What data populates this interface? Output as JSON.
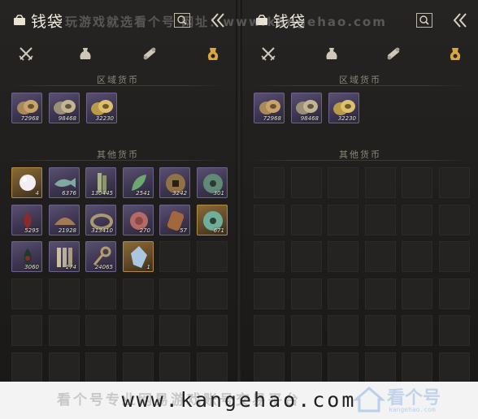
{
  "left_panel": {
    "title": "钱袋",
    "tabs": [
      {
        "icon": "crossed-swords-icon",
        "active": false
      },
      {
        "icon": "pouch-icon",
        "active": false
      },
      {
        "icon": "scroll-icon",
        "active": false
      },
      {
        "icon": "coin-pouch-icon",
        "active": true
      }
    ],
    "regional_label": "区域货币",
    "other_label": "其他货币",
    "regional_items": [
      {
        "icon": "coin-pile-icon",
        "qty": "72968",
        "rarity": "purple"
      },
      {
        "icon": "coin-pile-icon",
        "qty": "98468",
        "rarity": "purple"
      },
      {
        "icon": "coin-pile-icon",
        "qty": "32230",
        "rarity": "purple"
      }
    ],
    "other_items": [
      {
        "icon": "pearl-icon",
        "qty": "4",
        "rarity": "gold"
      },
      {
        "icon": "jade-fish-icon",
        "qty": "6376",
        "rarity": "purple"
      },
      {
        "icon": "bamboo-slip-icon",
        "qty": "130445",
        "rarity": "purple"
      },
      {
        "icon": "green-leaf-icon",
        "qty": "2541",
        "rarity": "purple"
      },
      {
        "icon": "square-hole-coin-icon",
        "qty": "3242",
        "rarity": "purple"
      },
      {
        "icon": "green-coin-icon",
        "qty": "301",
        "rarity": "purple"
      },
      {
        "icon": "red-lotus-icon",
        "qty": "5295",
        "rarity": "purple"
      },
      {
        "icon": "half-shell-icon",
        "qty": "21928",
        "rarity": "purple"
      },
      {
        "icon": "jade-bracelet-icon",
        "qty": "313410",
        "rarity": "purple"
      },
      {
        "icon": "red-stone-icon",
        "qty": "270",
        "rarity": "purple"
      },
      {
        "icon": "carved-token-icon",
        "qty": "57",
        "rarity": "purple"
      },
      {
        "icon": "jade-disc-icon",
        "qty": "671",
        "rarity": "gold"
      },
      {
        "icon": "dark-lotus-icon",
        "qty": "3060",
        "rarity": "purple"
      },
      {
        "icon": "bamboo-scrolls-icon",
        "qty": "174",
        "rarity": "purple"
      },
      {
        "icon": "key-icon",
        "qty": "24065",
        "rarity": "purple"
      },
      {
        "icon": "crystal-icon",
        "qty": "1",
        "rarity": "gold"
      }
    ]
  },
  "right_panel": {
    "title": "钱袋",
    "tabs": [
      {
        "icon": "crossed-swords-icon",
        "active": false
      },
      {
        "icon": "pouch-icon",
        "active": false
      },
      {
        "icon": "scroll-icon",
        "active": false
      },
      {
        "icon": "coin-pouch-icon",
        "active": true
      }
    ],
    "regional_label": "区域货币",
    "other_label": "其他货币",
    "regional_items": [
      {
        "icon": "coin-pile-icon",
        "qty": "72968",
        "rarity": "purple"
      },
      {
        "icon": "coin-pile-icon",
        "qty": "98468",
        "rarity": "purple"
      },
      {
        "icon": "coin-pile-icon",
        "qty": "32230",
        "rarity": "purple"
      }
    ]
  },
  "watermark": {
    "top_text": "玩游戏就选看个号  网址：www.kangehao.com",
    "bottom_text": "看个号专业网易游戏账号交易平台",
    "url": "www.kangehao.com",
    "logo_text": "看个号",
    "logo_sub": "kangehao.com"
  },
  "colors": {
    "accent_gold": "#c9a24a",
    "rarity_purple": "#5a4f70",
    "rarity_gold": "#8a6a35",
    "background": "#1b1a19"
  }
}
